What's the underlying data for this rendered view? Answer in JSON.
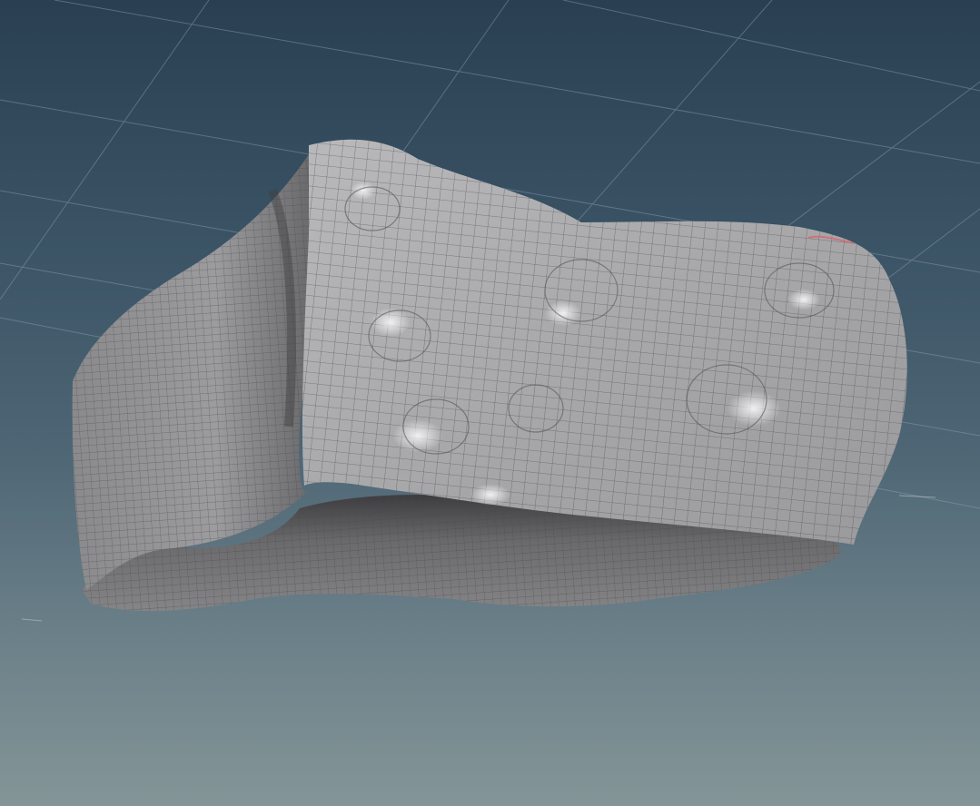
{
  "viewport": {
    "background_top": "#2a4052",
    "background_bottom": "#849597",
    "grid_color": "#8fa3b0",
    "mesh_base_color": "#a9a9ab",
    "mesh_shadow_color": "#4a4a4d",
    "mesh_highlight_color": "#e8e8ea",
    "wire_color": "#4f4f52",
    "accent_color": "#d9646e",
    "object_type": "polygon-mesh-rock",
    "shading_mode": "smooth-shaded-wireframe"
  }
}
